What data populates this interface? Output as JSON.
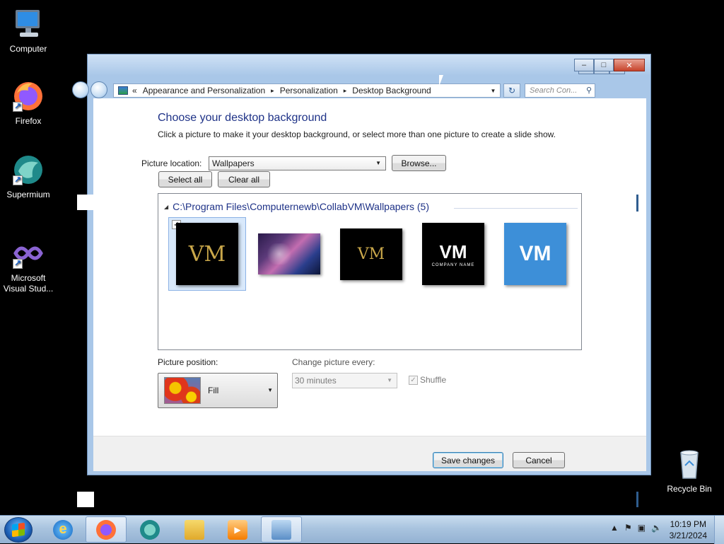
{
  "desktop": {
    "icons": [
      {
        "label": "Computer"
      },
      {
        "label": "Firefox"
      },
      {
        "label": "Supermium"
      },
      {
        "label_line1": "Microsoft",
        "label_line2": "Visual Stud..."
      },
      {
        "label": "Recycle Bin"
      }
    ]
  },
  "window": {
    "address": {
      "chevron": "«",
      "crumbs": [
        "Appearance and Personalization",
        "Personalization",
        "Desktop Background"
      ],
      "separator": "▸"
    },
    "search_placeholder": "Search Con...",
    "title": "Choose your desktop background",
    "subtitle": "Click a picture to make it your desktop background, or select more than one picture to create a slide show.",
    "picture_location_label": "Picture location:",
    "picture_location_value": "Wallpapers",
    "browse_label": "Browse...",
    "select_all_label": "Select all",
    "clear_all_label": "Clear all",
    "group_title": "C:\\Program Files\\Computernewb\\CollabVM\\Wallpapers (5)",
    "thumbnails": [
      {
        "text": "VM",
        "selected": true,
        "checked": true
      },
      {
        "text": "",
        "selected": false,
        "checked": false
      },
      {
        "text": "VM",
        "selected": false,
        "checked": false
      },
      {
        "text": "VM",
        "subtext": "COMPANY NAME",
        "selected": false,
        "checked": false
      },
      {
        "text": "VM",
        "selected": false,
        "checked": false
      }
    ],
    "picture_position_label": "Picture position:",
    "picture_position_value": "Fill",
    "change_picture_label": "Change picture every:",
    "change_picture_value": "30 minutes",
    "shuffle_label": "Shuffle",
    "shuffle_checked": true,
    "save_label": "Save changes",
    "cancel_label": "Cancel"
  },
  "taskbar": {
    "apps": [
      "internet-explorer",
      "firefox",
      "supermium",
      "file-explorer",
      "media-player",
      "control-panel"
    ],
    "active_app": "control-panel",
    "time": "10:19 PM",
    "date": "3/21/2024"
  }
}
